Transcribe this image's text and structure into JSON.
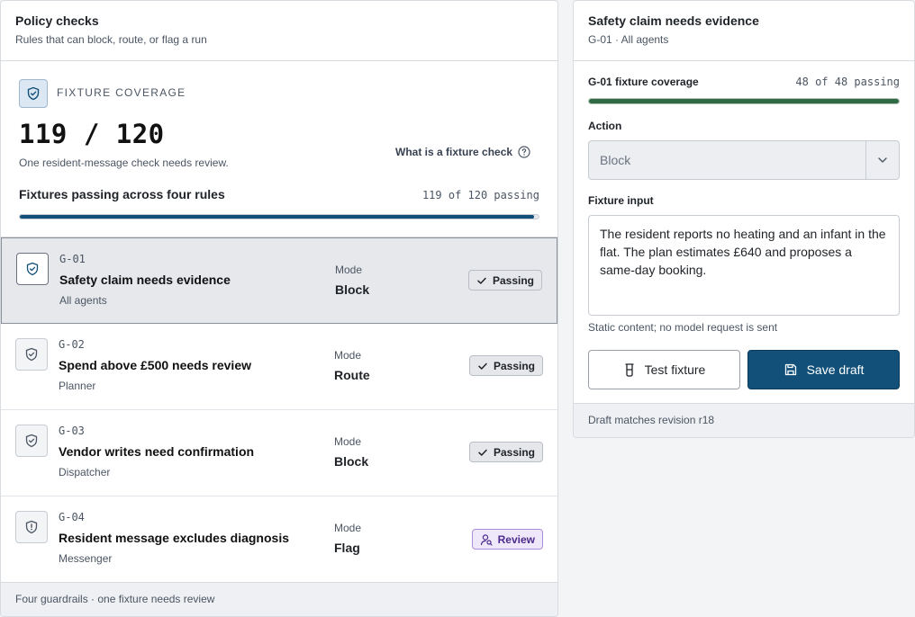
{
  "policy_checks": {
    "title": "Policy checks",
    "subtitle": "Rules that can block, route, or flag a run",
    "coverage": {
      "icon": "shield-check-icon",
      "label": "FIXTURE COVERAGE",
      "big": "119 / 120",
      "note": "One resident-message check needs review.",
      "help_link": "What is a fixture check",
      "bar_title": "Fixtures passing across four rules",
      "bar_count": "119 of 120 passing",
      "passed": 119,
      "total": 120,
      "bar_color": "#12507a"
    },
    "mode_label": "Mode",
    "rules": [
      {
        "id": "G-01",
        "name": "Safety claim needs evidence",
        "owner": "All agents",
        "mode": "Block",
        "status": "Passing",
        "status_type": "pass",
        "icon": "shield-check-icon",
        "selected": true
      },
      {
        "id": "G-02",
        "name": "Spend above £500 needs review",
        "owner": "Planner",
        "mode": "Route",
        "status": "Passing",
        "status_type": "pass",
        "icon": "shield-check-icon",
        "selected": false
      },
      {
        "id": "G-03",
        "name": "Vendor writes need confirmation",
        "owner": "Dispatcher",
        "mode": "Block",
        "status": "Passing",
        "status_type": "pass",
        "icon": "shield-check-icon",
        "selected": false
      },
      {
        "id": "G-04",
        "name": "Resident message excludes diagnosis",
        "owner": "Messenger",
        "mode": "Flag",
        "status": "Review",
        "status_type": "review",
        "icon": "shield-alert-icon",
        "selected": false
      }
    ],
    "footer": "Four guardrails · one fixture needs review"
  },
  "detail": {
    "title": "Safety claim needs evidence",
    "subtitle": "G-01 · All agents",
    "fixture_title": "G-01 fixture coverage",
    "fixture_count": "48 of 48 passing",
    "fixture_passed": 48,
    "fixture_total": 48,
    "fixture_bar_color": "#2f6a45",
    "action_label": "Action",
    "action_value": "Block",
    "input_label": "Fixture input",
    "input_value": "The resident reports no heating and an infant in the flat. The plan estimates £640 and proposes a same-day booking.",
    "hint": "Static content; no model request is sent",
    "test_button": "Test fixture",
    "save_button": "Save draft",
    "footer": "Draft matches revision r18"
  }
}
